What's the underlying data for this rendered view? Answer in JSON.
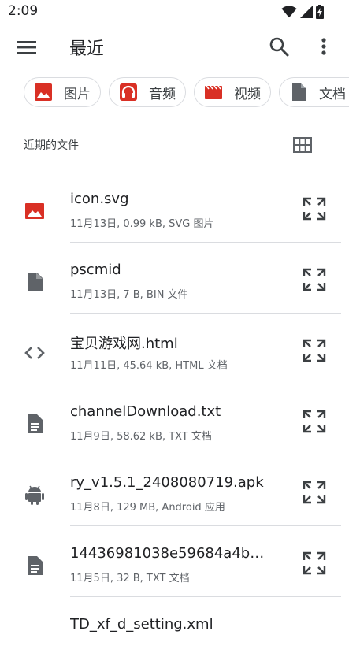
{
  "status_bar": {
    "time": "2:09"
  },
  "app_bar": {
    "title": "最近"
  },
  "chips": [
    {
      "label": "图片",
      "icon": "image-icon",
      "color": "#d93025"
    },
    {
      "label": "音频",
      "icon": "headphones-icon",
      "color": "#d93025"
    },
    {
      "label": "视频",
      "icon": "movie-icon",
      "color": "#d93025"
    },
    {
      "label": "文档",
      "icon": "document-icon",
      "color": "#5f6368"
    }
  ],
  "section": {
    "title": "近期的文件"
  },
  "files": [
    {
      "name": "icon.svg",
      "meta": "11月13日, 0.99 kB, SVG 图片",
      "icon": "image-file-icon"
    },
    {
      "name": "pscmid",
      "meta": "11月13日, 7 B, BIN 文件",
      "icon": "generic-file-icon"
    },
    {
      "name": "宝贝游戏网.html",
      "meta": "11月11日, 45.64 kB, HTML 文档",
      "icon": "code-file-icon"
    },
    {
      "name": "channelDownload.txt",
      "meta": "11月9日, 58.62 kB, TXT 文档",
      "icon": "text-file-icon"
    },
    {
      "name": "ry_v1.5.1_2408080719.apk",
      "meta": "11月8日, 129 MB, Android 应用",
      "icon": "android-file-icon"
    },
    {
      "name": "14436981038e59684a4b8...",
      "meta": "11月5日, 32 B, TXT 文档",
      "icon": "text-file-icon"
    },
    {
      "name": "TD_xf_d_setting.xml",
      "meta": "",
      "icon": "code-file-icon"
    }
  ],
  "colors": {
    "accent_red": "#d93025",
    "icon_gray": "#5f6368",
    "divider": "#dadce0"
  }
}
